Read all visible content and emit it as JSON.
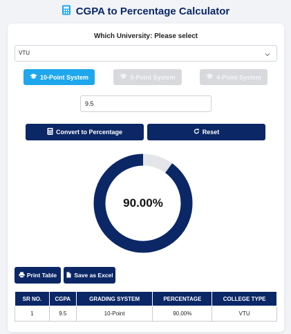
{
  "header": {
    "title": "CGPA to Percentage Calculator",
    "icon": "calculator-icon"
  },
  "form": {
    "university_label": "Which University: Please select",
    "university_selected": "VTU",
    "systems": [
      {
        "label": "10-Point System",
        "active": true
      },
      {
        "label": "5-Point System",
        "active": false
      },
      {
        "label": "4-Point System",
        "active": false
      }
    ],
    "cgpa_value": "9.5",
    "convert_label": "Convert to Percentage",
    "reset_label": "Reset"
  },
  "result": {
    "percentage_display": "90.00%",
    "percentage_fraction": 0.9,
    "ring_color": "#0b2766",
    "ring_bg_color": "#e4e5e8"
  },
  "tools": {
    "print_label": "Print Table",
    "excel_label": "Save as Excel"
  },
  "table": {
    "headers": [
      "SR NO.",
      "CGPA",
      "GRADING SYSTEM",
      "PERCENTAGE",
      "COLLEGE TYPE"
    ],
    "rows": [
      [
        "1",
        "9.5",
        "10-Point",
        "90.00%",
        "VTU"
      ]
    ]
  },
  "colors": {
    "primary": "#0b2766",
    "accent": "#1ea7ec",
    "disabled": "#d7d9dc"
  }
}
